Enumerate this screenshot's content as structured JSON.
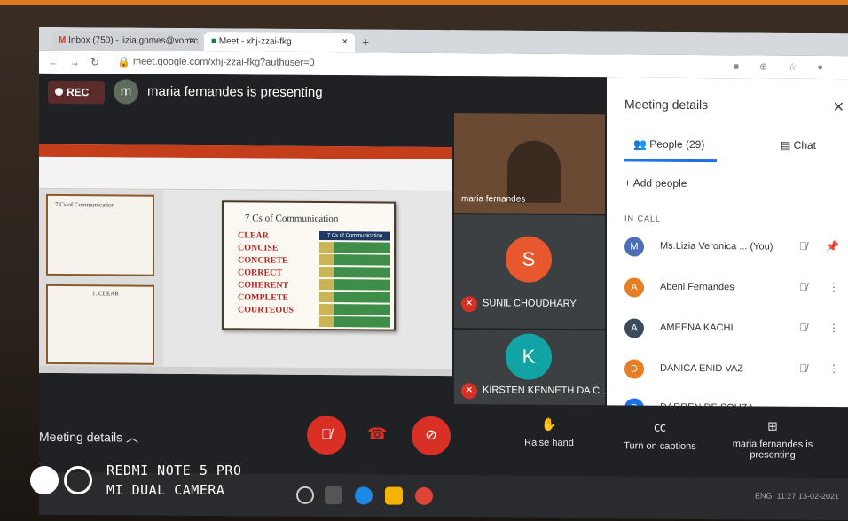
{
  "browser": {
    "tabs": [
      {
        "label": "Inbox (750) - lizia.gomes@vom.c"
      },
      {
        "label": "Meet - xhj-zzai-fkg"
      }
    ],
    "url": "meet.google.com/xhj-zzai-fkg?authuser=0"
  },
  "meet": {
    "rec_label": "REC",
    "presenter_initial": "m",
    "presenting_text": "maria fernandes is presenting",
    "slide_title": "7 Cs of Communication",
    "slide_items": [
      "CLEAR",
      "CONCISE",
      "CONCRETE",
      "CORRECT",
      "COHERENT",
      "COMPLETE",
      "COURTEOUS"
    ],
    "checklist_header": "7 Cs of Communication Checklist",
    "thumb_title": "7 Cs of Communication",
    "thumb2_title": "1. CLEAR",
    "tiles": [
      {
        "name": "maria fernandes"
      },
      {
        "initial": "S",
        "name": "SUNIL CHOUDHARY",
        "color": "#e8582e"
      },
      {
        "initial": "K",
        "name": "KIRSTEN KENNETH DA C...",
        "color": "#12a4a4"
      }
    ]
  },
  "panel": {
    "title": "Meeting details",
    "people_tab": "People (29)",
    "chat_tab": "Chat",
    "add_people": "Add people",
    "in_call": "IN CALL",
    "people": [
      {
        "initial": "M",
        "name": "Ms.Lizia Veronica ... (You)",
        "color": "#4a6fb5"
      },
      {
        "initial": "A",
        "name": "Abeni Fernandes",
        "color": "#e67e22"
      },
      {
        "initial": "A",
        "name": "AMEENA KACHI",
        "color": "#3c4a5c"
      },
      {
        "initial": "D",
        "name": "DANICA ENID VAZ",
        "color": "#e67e22"
      },
      {
        "initial": "D",
        "name": "DARREN DE SOUZA",
        "color": "#1a73e8"
      }
    ]
  },
  "bottom": {
    "meeting_details": "Meeting details",
    "raise_hand": "Raise hand",
    "captions": "Turn on captions",
    "presenting": "maria fernandes is presenting"
  },
  "watermark": {
    "line1": "REDMI NOTE 5 PRO",
    "line2": "MI DUAL CAMERA"
  },
  "taskbar": {
    "lang": "ENG",
    "time": "11:27",
    "date": "13-02-2021"
  }
}
